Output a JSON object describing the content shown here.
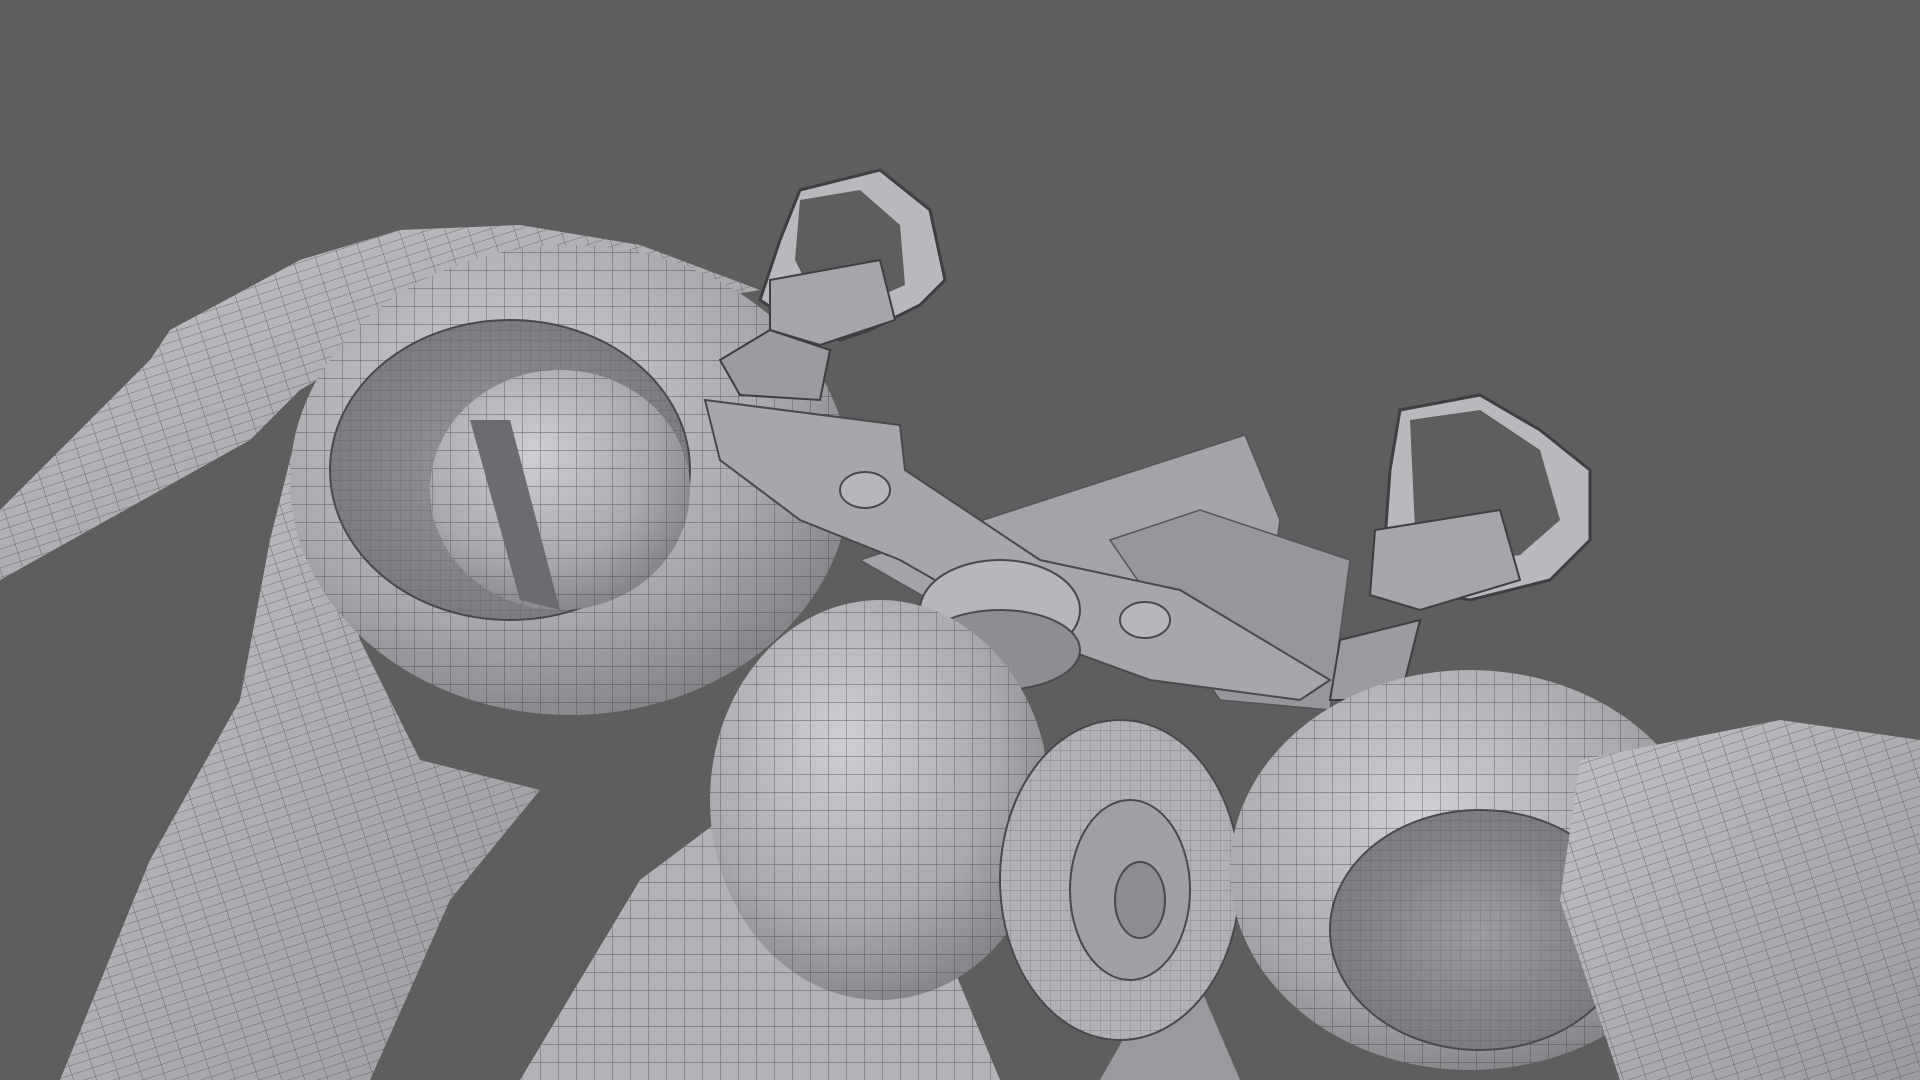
{
  "scene": {
    "background_color": "#5e5e5e",
    "surface_color": "#a9a8ac",
    "surface_light_color": "#c4c3c7",
    "surface_shadow_color": "#7d7c80",
    "wire_color": "#3c3b40",
    "objects": [
      {
        "id": "left-wing-fin",
        "label": ""
      },
      {
        "id": "left-engine-housing",
        "label": ""
      },
      {
        "id": "left-engine-sphere",
        "label": ""
      },
      {
        "id": "left-pedal",
        "label": ""
      },
      {
        "id": "right-pedal",
        "label": ""
      },
      {
        "id": "dorsal-fin",
        "label": ""
      },
      {
        "id": "center-hub",
        "label": ""
      },
      {
        "id": "front-wheel",
        "label": ""
      },
      {
        "id": "right-engine-housing",
        "label": ""
      },
      {
        "id": "right-wing-fin",
        "label": ""
      },
      {
        "id": "lower-chassis",
        "label": ""
      }
    ]
  }
}
